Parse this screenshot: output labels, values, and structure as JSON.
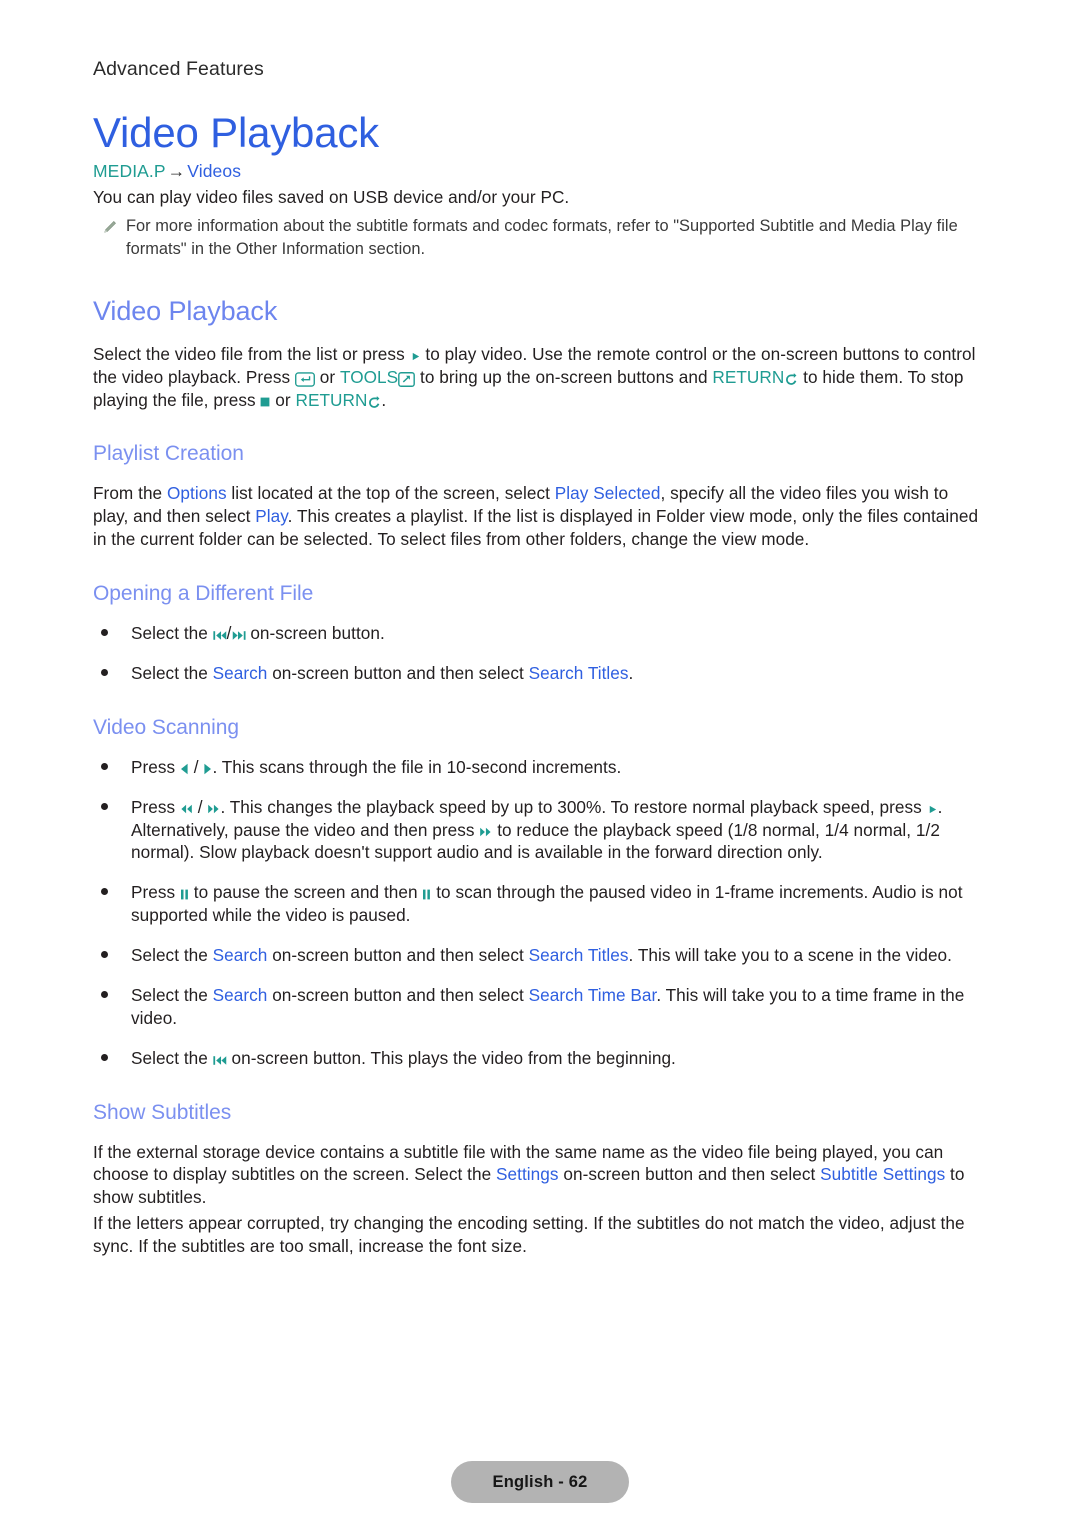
{
  "page": {
    "running_header": "Advanced Features",
    "footer_label": "English - 62"
  },
  "colors": {
    "chapter_title": "#2f5fe0",
    "section_title": "#6d85ee",
    "sub_title": "#7b90f0",
    "link_blue": "#2f5fe0",
    "link_teal": "#1f9c92",
    "body_text": "#231f20",
    "footer_pill_bg": "#b3b3b3"
  },
  "chapter": {
    "title": "Video Playback",
    "breadcrumb": {
      "root": "MEDIA.P",
      "arrow": "→",
      "leaf": "Videos"
    },
    "intro": "You can play video files saved on USB device and/or your PC.",
    "note": {
      "icon": "pencil-note-icon",
      "text": "For more information about the subtitle formats and codec formats, refer to \"Supported Subtitle and Media Play file formats\" in the Other Information section."
    }
  },
  "section": {
    "title": "Video Playback",
    "intro": {
      "p1": "Select the video file from the list or press",
      "icon_play": "play-icon",
      "p2": "to play video. Use the remote control or the on-screen buttons to control the video playback. Press",
      "icon_enter": "enter-key-icon",
      "p3": "or",
      "label_tools": "TOOLS",
      "icon_tools": "tools-key-icon",
      "p4": "to bring up the on-screen buttons and",
      "label_return": "RETURN",
      "icon_return": "return-key-icon",
      "p5": "to hide them. To stop playing the file, press",
      "icon_stop": "stop-icon",
      "p6": "or",
      "label_return2": "RETURN",
      "icon_return2": "return-key-icon",
      "p7": "."
    }
  },
  "playlist_creation": {
    "title": "Playlist Creation",
    "body": {
      "t1": "From the",
      "link_options": "Options",
      "t2": "list located at the top of the screen, select",
      "link_play_selected": "Play Selected",
      "t3": ", specify all the video files you wish to play, and then select",
      "link_play": "Play",
      "t4": ". This creates a playlist. If the list is displayed in Folder view mode, only the files contained in the current folder can be selected. To select files from other folders, change the view mode."
    }
  },
  "opening_file": {
    "title": "Opening a Different File",
    "bullets": [
      {
        "t1": "Select the",
        "icon_a": "skip-backward-icon",
        "sep": "/",
        "icon_b": "skip-forward-icon",
        "t2": "on-screen button."
      },
      {
        "t1": "Select the",
        "link1": "Search",
        "t2": "on-screen button and then select",
        "link2": "Search Titles",
        "t3": "."
      }
    ]
  },
  "video_scanning": {
    "title": "Video Scanning",
    "bullets": [
      {
        "t1": "Press",
        "icon_a": "left-arrow-icon",
        "sep": "/",
        "icon_b": "right-arrow-icon",
        "t2": ". This scans through the file in 10-second increments."
      },
      {
        "t1": "Press",
        "icon_a": "rewind-icon",
        "sep": "/",
        "icon_b": "fast-forward-icon",
        "t2": ". This changes the playback speed by up to 300%. To restore normal playback speed, press",
        "icon_c": "play-icon",
        "t3": ". Alternatively, pause the video and then press",
        "icon_d": "fast-forward-icon",
        "t4": "to reduce the playback speed (1/8 normal, 1/4 normal, 1/2 normal). Slow playback doesn't support audio and is available in the forward direction only."
      },
      {
        "t1": "Press",
        "icon_a": "pause-icon",
        "t2": "to pause the screen and then",
        "icon_b": "pause-icon",
        "t3": "to scan through the paused video in 1-frame increments. Audio is not supported while the video is paused."
      },
      {
        "t1": "Select the",
        "link1": "Search",
        "t2": "on-screen button and then select",
        "link2": "Search Titles",
        "t3": ". This will take you to a scene in the video."
      },
      {
        "t1": "Select the",
        "link1": "Search",
        "t2": "on-screen button and then select",
        "link2": "Search Time Bar",
        "t3": ". This will take you to a time frame in the video."
      },
      {
        "t1": "Select the",
        "icon_a": "skip-backward-icon",
        "t2": "on-screen button. This plays the video from the beginning."
      }
    ]
  },
  "show_subtitles": {
    "title": "Show Subtitles",
    "para1": {
      "t1": "If the external storage device contains a subtitle file with the same name as the video file being played, you can choose to display subtitles on the screen. Select the",
      "link1": "Settings",
      "t2": "on-screen button and then select",
      "link2": "Subtitle Settings",
      "t3": "to show subtitles."
    },
    "para2": "If the letters appear corrupted, try changing the encoding setting. If the subtitles do not match the video, adjust the sync. If the subtitles are too small, increase the font size."
  }
}
